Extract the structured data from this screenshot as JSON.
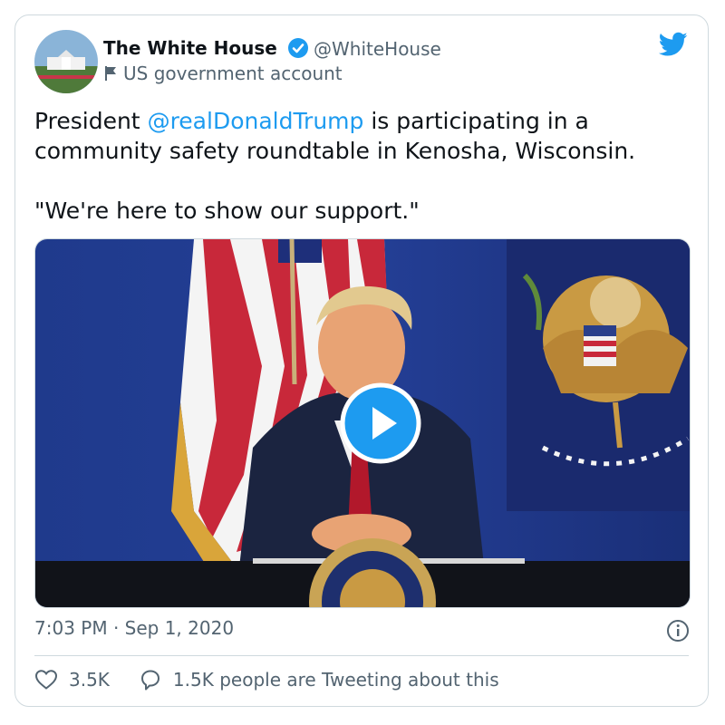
{
  "tweet": {
    "author_name": "The White House",
    "handle": "@WhiteHouse",
    "account_label": "US government account",
    "text_prefix": "President ",
    "mention": "@realDonaldTrump",
    "text_suffix": " is participating in a\ncommunity safety roundtable in Kenosha, Wisconsin.\n\n\"We're here to show our support.\"",
    "timestamp": "7:03 PM · Sep 1, 2020",
    "likes": "3.5K",
    "tweeting": "1.5K people are Tweeting about this"
  },
  "icons": {
    "verified": "verified-badge-icon",
    "flag": "flag-icon",
    "bird": "twitter-bird-icon",
    "play": "play-icon",
    "info": "info-icon",
    "heart": "heart-icon",
    "bubble": "speech-bubble-icon"
  },
  "colors": {
    "accent": "#1d9bf0",
    "text": "#0f1419",
    "secondary": "#536471",
    "border": "#cfd9de"
  }
}
